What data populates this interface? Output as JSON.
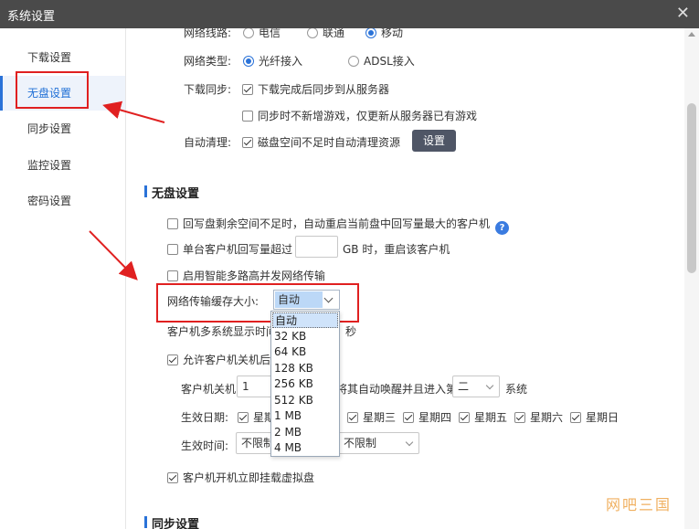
{
  "window": {
    "title": "系统设置"
  },
  "sidebar": {
    "items": [
      {
        "label": "下载设置",
        "active": false
      },
      {
        "label": "无盘设置",
        "active": true
      },
      {
        "label": "同步设置",
        "active": false
      },
      {
        "label": "监控设置",
        "active": false
      },
      {
        "label": "密码设置",
        "active": false
      }
    ]
  },
  "download": {
    "line_label": "网络线路:",
    "line_options": [
      "电信",
      "联通",
      "移动"
    ],
    "line_selected": "移动",
    "type_label": "网络类型:",
    "type_options": [
      "光纤接入",
      "ADSL接入"
    ],
    "type_selected": "光纤接入",
    "sync_label": "下载同步:",
    "sync_opt1": "下载完成后同步到从服务器",
    "sync_opt1_checked": true,
    "sync_opt2": "同步时不新增游戏，仅更新从服务器已有游戏",
    "sync_opt2_checked": false,
    "clean_label": "自动清理:",
    "clean_opt": "磁盘空间不足时自动清理资源",
    "clean_checked": true,
    "settings_button": "设置"
  },
  "diskless": {
    "section_title": "无盘设置",
    "opt1": "回写盘剩余空间不足时，自动重启当前盘中回写量最大的客户机",
    "opt1_checked": false,
    "help_icon": "?",
    "opt2_prefix": "单台客户机回写量超过",
    "opt2_value": "",
    "opt2_suffix": "GB 时，重启该客户机",
    "opt2_checked": false,
    "opt3": "启用智能多路高并发网络传输",
    "opt3_checked": false,
    "cache_label": "网络传输缓存大小:",
    "cache_selected": "自动",
    "cache_options": [
      "自动",
      "32 KB",
      "64 KB",
      "128 KB",
      "256 KB",
      "512 KB",
      "1 MB",
      "2 MB",
      "4 MB"
    ],
    "display_label_partial": "客户机多系统显示时间",
    "display_unit": "秒",
    "shutdown_opt_partial": "允许客户机关机后",
    "shutdown_opt_checked": true,
    "shutdown_label": "客户机关机",
    "shutdown_value": "1",
    "wake_text_partial": "将其自动唤醒并且进入第",
    "wake_system_value": "二",
    "wake_system_suffix": "系统",
    "effective_date_label": "生效日期:",
    "weekdays": [
      "星期",
      "星期三",
      "星期四",
      "星期五",
      "星期六",
      "星期日"
    ],
    "effective_time_label": "生效时间:",
    "time_from": "不限制",
    "time_to": "不限制",
    "mount_opt": "客户机开机立即挂载虚拟盘",
    "mount_checked": true
  },
  "sync": {
    "section_title": "同步设置"
  },
  "watermark": "网吧三国"
}
